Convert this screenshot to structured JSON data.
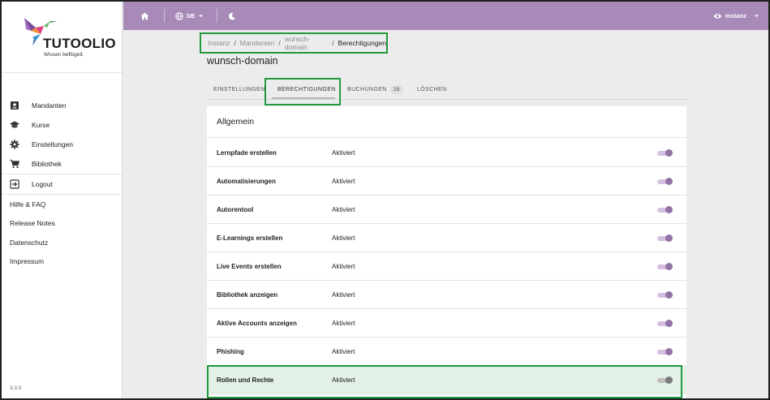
{
  "sidebar": {
    "logo_text": "TUTOOLIO",
    "logo_tagline": "Wissen beflügelt.",
    "menu": [
      {
        "label": "Mandanten",
        "icon": "user-card-icon"
      },
      {
        "label": "Kurse",
        "icon": "graduation-cap-icon"
      },
      {
        "label": "Einstellungen",
        "icon": "gear-icon"
      },
      {
        "label": "Bibliothek",
        "icon": "cart-icon"
      },
      {
        "label": "Logout",
        "icon": "logout-icon"
      }
    ],
    "links": [
      "Hilfe & FAQ",
      "Release Notes",
      "Datenschutz",
      "Impressum"
    ],
    "version": "3.3.0"
  },
  "topbar": {
    "language": "DE",
    "instance_label": "Instanz",
    "colors": {
      "bar": "#a88ab8"
    }
  },
  "breadcrumb": [
    "Instanz",
    "Mandanten",
    "wunsch-domain",
    "Berechtigungen"
  ],
  "page_title": "wunsch-domain",
  "tabs": [
    {
      "label": "EINSTELLUNGEN"
    },
    {
      "label": "BERECHTIGUNGEN",
      "active": true
    },
    {
      "label": "BUCHUNGEN",
      "badge": "28"
    },
    {
      "label": "LÖSCHEN"
    }
  ],
  "card": {
    "title": "Allgemein",
    "rows": [
      {
        "label": "Lernpfade erstellen",
        "status": "Aktiviert",
        "enabled": true
      },
      {
        "label": "Automatisierungen",
        "status": "Aktiviert",
        "enabled": true
      },
      {
        "label": "Autorentool",
        "status": "Aktiviert",
        "enabled": true
      },
      {
        "label": "E-Learnings erstellen",
        "status": "Aktiviert",
        "enabled": true
      },
      {
        "label": "Live Events erstellen",
        "status": "Aktiviert",
        "enabled": true
      },
      {
        "label": "Bibliothek anzeigen",
        "status": "Aktiviert",
        "enabled": true
      },
      {
        "label": "Aktive Accounts anzeigen",
        "status": "Aktiviert",
        "enabled": true
      },
      {
        "label": "Phishing",
        "status": "Aktiviert",
        "enabled": true
      },
      {
        "label": "Rollen und Rechte",
        "status": "Aktiviert",
        "enabled": true,
        "highlighted": true
      }
    ]
  },
  "colors": {
    "accent": "#a88ab8",
    "toggle_on": "#9372a6",
    "highlight_border": "#1f9a3e",
    "highlight_bg": "#e3f1e6"
  }
}
